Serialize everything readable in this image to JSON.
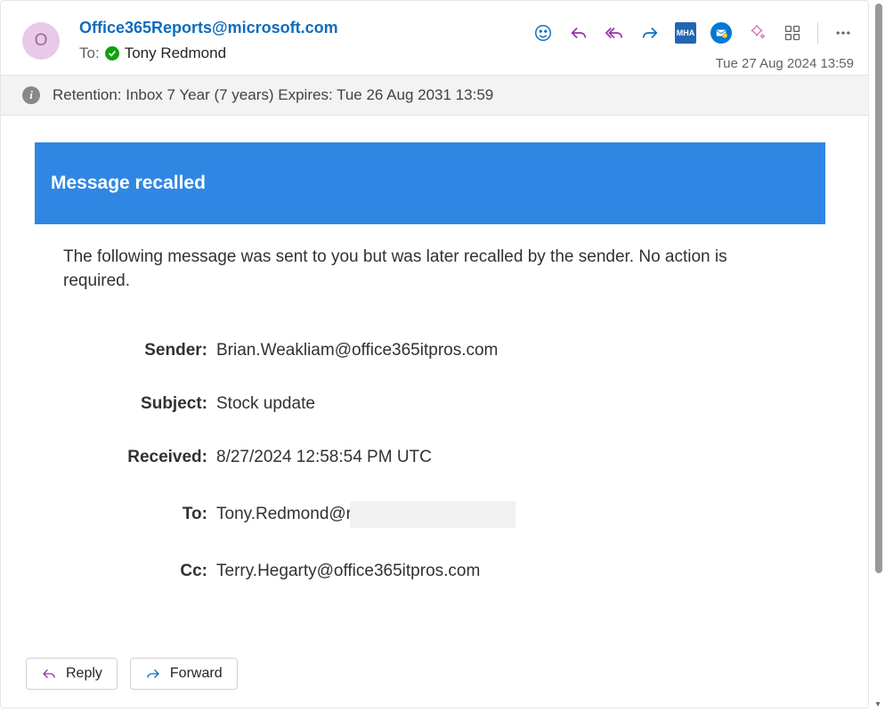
{
  "header": {
    "avatar_initial": "O",
    "sender": "Office365Reports@microsoft.com",
    "to_label": "To:",
    "to_name": "Tony Redmond",
    "timestamp": "Tue 27 Aug 2024 13:59",
    "mha_label": "MHA"
  },
  "retention": {
    "text": "Retention: Inbox 7 Year (7 years) Expires: Tue 26 Aug 2031 13:59"
  },
  "recall": {
    "banner_title": "Message recalled",
    "intro": "The following message was sent to you but was later recalled by the sender. No action is required.",
    "rows": [
      {
        "label": "Sender:",
        "value": "Brian.Weakliam@office365itpros.com"
      },
      {
        "label": "Subject:",
        "value": "Stock update"
      },
      {
        "label": "Received:",
        "value": "8/27/2024 12:58:54 PM UTC"
      },
      {
        "label": "To:",
        "value": "Tony.Redmond@r",
        "redacted": true
      },
      {
        "label": "Cc:",
        "value": "Terry.Hegarty@office365itpros.com"
      }
    ]
  },
  "footer": {
    "reply": "Reply",
    "forward": "Forward"
  }
}
